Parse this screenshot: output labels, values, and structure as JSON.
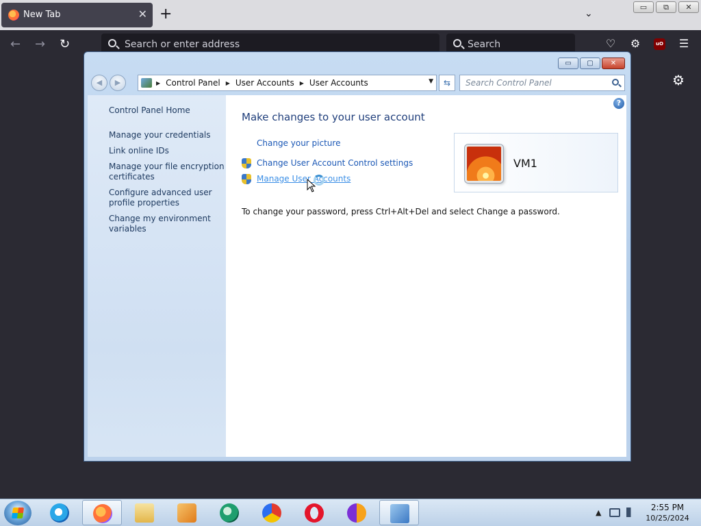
{
  "browser": {
    "tab_title": "New Tab",
    "tab_close": "✕",
    "new_tab": "+",
    "list_all_tabs": "⌄",
    "url_placeholder": "Search or enter address",
    "search_placeholder": "Search",
    "nav_back": "←",
    "nav_forward": "→",
    "nav_reload": "↻",
    "pocket": "♡",
    "extensions": "⚙",
    "ublock": "uO",
    "menu": "☰",
    "settings": "⚙"
  },
  "vm_controls": {
    "minimize": "▭",
    "restore": "⧉",
    "close": "✕"
  },
  "window": {
    "caption": {
      "minimize": "▭",
      "maximize": "▢",
      "close": "✕"
    },
    "address": {
      "back": "◀",
      "forward": "▶",
      "crumbs": [
        "Control Panel",
        "User Accounts",
        "User Accounts"
      ],
      "separator": "▶",
      "dropdown": "▼",
      "refresh": "⇆"
    },
    "search_placeholder": "Search Control Panel",
    "left_links": [
      "Control Panel Home",
      "Manage your credentials",
      "Link online IDs",
      "Manage your file encryption certificates",
      "Configure advanced user profile properties",
      "Change my environment variables"
    ],
    "help": "?",
    "heading": "Make changes to your user account",
    "tasks": [
      "Change your picture",
      "Change User Account Control settings",
      "Manage User Accounts"
    ],
    "password_hint": "To change your password, press Ctrl+Alt+Del and select Change a password.",
    "user_name": "VM1"
  },
  "taskbar": {
    "apps": [
      "start-button",
      "internet-explorer-icon",
      "firefox-icon",
      "file-explorer-icon",
      "media-player-icon",
      "browser-app-icon",
      "chrome-style-icon",
      "opera-icon",
      "browser-lock-icon",
      "control-panel-icon"
    ],
    "tray_arrow": "▲",
    "time": "2:55 PM",
    "date": "10/25/2024"
  },
  "colors": {
    "link": "#1a57b5",
    "heading": "#1e3d7a",
    "hover_link": "#3a8ee6"
  }
}
